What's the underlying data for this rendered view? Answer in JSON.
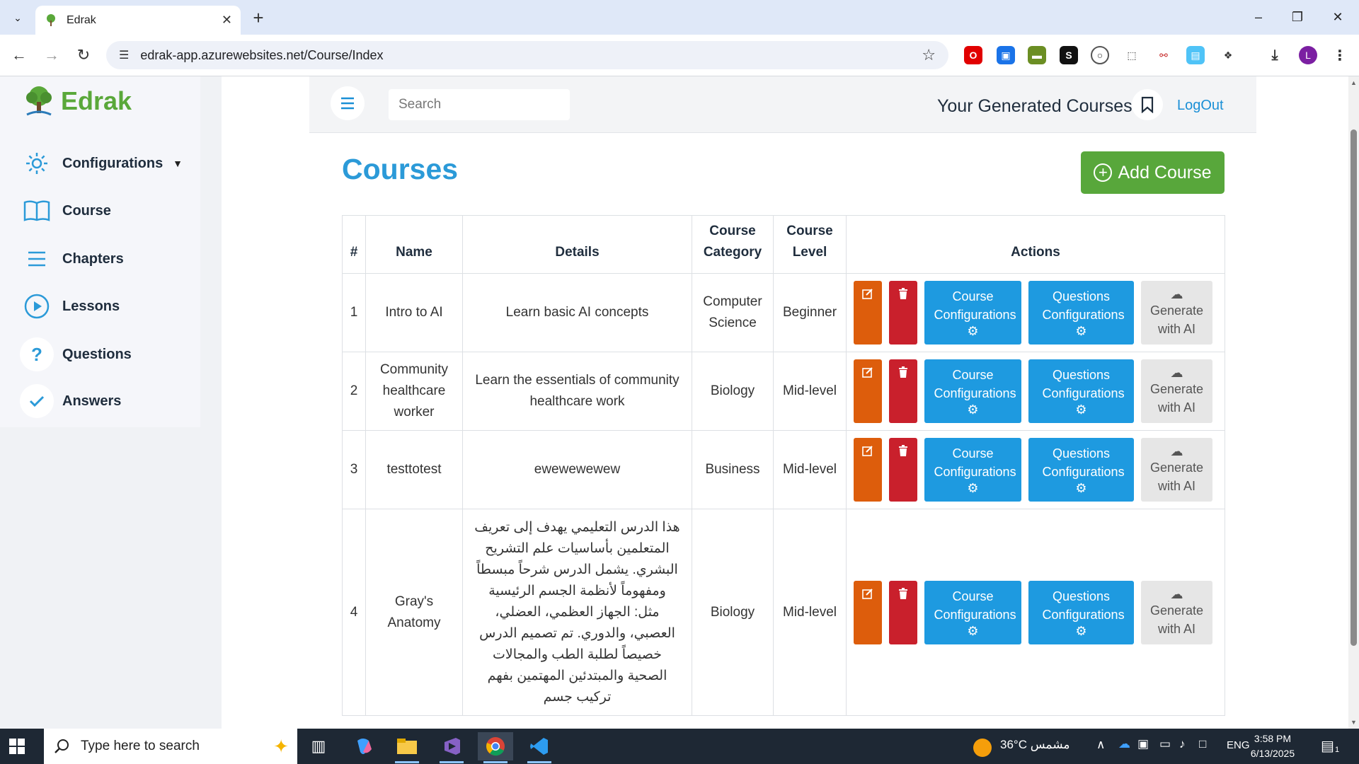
{
  "browser": {
    "tab_title": "Edrak",
    "url": "edrak-app.azurewebsites.net/Course/Index",
    "profile_initial": "L"
  },
  "sidebar": {
    "brand": "Edrak",
    "items": [
      {
        "label": "Configurations",
        "icon": "gear-icon"
      },
      {
        "label": "Course",
        "icon": "book-icon"
      },
      {
        "label": "Chapters",
        "icon": "list-icon"
      },
      {
        "label": "Lessons",
        "icon": "play-circle-icon"
      },
      {
        "label": "Questions",
        "icon": "question-icon"
      },
      {
        "label": "Answers",
        "icon": "check-icon"
      }
    ]
  },
  "topbar": {
    "search_placeholder": "Search",
    "generated_courses": "Your Generated Courses",
    "logout": "LogOut"
  },
  "main": {
    "title": "Courses",
    "add_button": "Add Course"
  },
  "table": {
    "headers": [
      "#",
      "Name",
      "Details",
      "Course Category",
      "Course Level",
      "Actions"
    ],
    "actions": {
      "course_conf": "Course Configurations",
      "questions_conf": "Questions Configurations",
      "generate": "Generate with AI"
    },
    "rows": [
      {
        "num": "1",
        "name": "Intro to AI",
        "details": "Learn basic AI concepts",
        "category": "Computer Science",
        "level": "Beginner"
      },
      {
        "num": "2",
        "name": "Community healthcare worker",
        "details": "Learn the essentials of community healthcare work",
        "category": "Biology",
        "level": "Mid-level"
      },
      {
        "num": "3",
        "name": "testtotest",
        "details": "ewewewewew",
        "category": "Business",
        "level": "Mid-level"
      },
      {
        "num": "4",
        "name": "Gray's Anatomy",
        "details": "هذا الدرس التعليمي يهدف إلى تعريف المتعلمين بأساسيات علم التشريح البشري. يشمل الدرس شرحاً مبسطاً ومفهوماً لأنظمة الجسم الرئيسية مثل: الجهاز العظمي، العضلي، العصبي، والدوري. تم تصميم الدرس خصيصاً لطلبة الطب والمجالات الصحية والمبتدئين المهتمين بفهم تركيب جسم",
        "category": "Biology",
        "level": "Mid-level"
      }
    ]
  },
  "taskbar": {
    "search_placeholder": "Type here to search",
    "weather": "36°C  مشمس",
    "lang": "ENG",
    "time": "3:58 PM",
    "date": "6/13/2025",
    "notif_count": "1"
  }
}
